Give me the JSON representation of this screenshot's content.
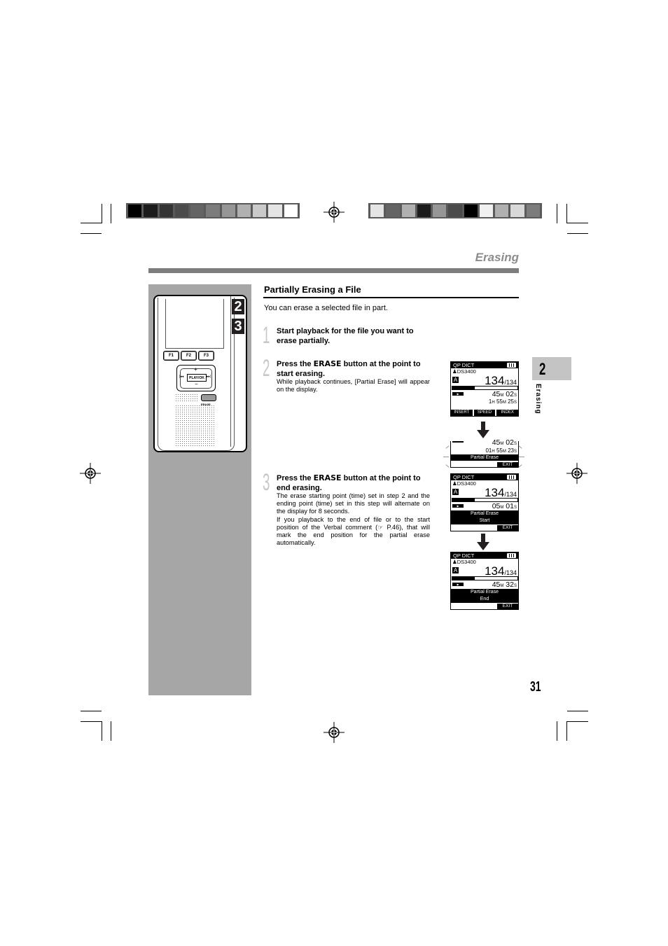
{
  "colors": {
    "section_title": "#8c8c8c",
    "header_rule": "#7d7d7d",
    "left_column": "#a6a6a6",
    "chapter_tab": "#c4c4c4",
    "step_number": "#c8c8c8",
    "colorbar_left": [
      "#000000",
      "#1c1c1c",
      "#343434",
      "#4b4b4b",
      "#646464",
      "#7c7c7c",
      "#969696",
      "#b0b0b0",
      "#cacaca",
      "#e4e4e4",
      "#ffffff"
    ],
    "colorbar_right": [
      "#e4e4e4",
      "#646464",
      "#b0b0b0",
      "#1c1c1c",
      "#969696",
      "#4b4b4b",
      "#000000",
      "#f0f0f0",
      "#b0b0b0",
      "#d8d8d8",
      "#7c7c7c"
    ]
  },
  "header": {
    "section_title": "Erasing"
  },
  "chapter": {
    "number": "2",
    "label": "Erasing"
  },
  "page_number": "31",
  "device": {
    "function_buttons": [
      "F1",
      "F2",
      "F3"
    ],
    "play_ok": "PLAY/OK",
    "plus": "+",
    "minus": "−",
    "prev": "|◂◂",
    "next": "▸▸|",
    "erase_label": "ERASE",
    "step_badges": [
      "2",
      "3"
    ]
  },
  "main": {
    "heading": "Partially Erasing a File",
    "intro": "You can erase a selected file in part.",
    "steps": [
      {
        "number": "1",
        "title": "Start playback for the file you want to erase partially.",
        "description": ""
      },
      {
        "number": "2",
        "title_pre": "Press the ",
        "title_key": "ERASE",
        "title_post": " button at the point to start erasing.",
        "description": "While playback continues, [Partial Erase] will appear on the display."
      },
      {
        "number": "3",
        "title_pre": "Press the ",
        "title_key": "ERASE",
        "title_post": " button at the point to end erasing.",
        "description": "The erase starting point (time) set in step 2 and the ending point (time) set in this step will alternate on the display for 8 seconds.",
        "description2": "If you playback to the end of file or to the start position of the Verbal comment (☞ P.46), that will mark the end position for the partial erase automatically."
      }
    ]
  },
  "displays": {
    "d1": {
      "mode": "QP DICT",
      "user": "DS3400",
      "folder": "A",
      "file": "134",
      "total": "/134",
      "progress": 0.35,
      "time_m": "45",
      "time_s": "02",
      "sub_h": "1",
      "sub_m": "55",
      "sub_s": "25",
      "softkeys": [
        "INSERT",
        "SPEED",
        "INDEX"
      ]
    },
    "d2": {
      "time_m": "45",
      "time_s": "02",
      "sub_h": "01",
      "sub_m": "55",
      "sub_s": "23",
      "message": "Partial Erase",
      "exit": "EXIT"
    },
    "d3": {
      "mode": "QP DICT",
      "user": "DS3400",
      "folder": "A",
      "file": "134",
      "total": "/134",
      "progress": 0.35,
      "time_m": "05",
      "time_s": "01",
      "message1": "Partial Erase",
      "message2": "Start",
      "exit": "EXIT"
    },
    "d4": {
      "mode": "QP DICT",
      "user": "DS3400",
      "folder": "A",
      "file": "134",
      "total": "/134",
      "progress": 0.35,
      "time_m": "45",
      "time_s": "32",
      "message1": "Partial Erase",
      "message2": "End",
      "exit": "EXIT"
    },
    "units": {
      "h": "H",
      "m": "M",
      "s": "S"
    }
  }
}
